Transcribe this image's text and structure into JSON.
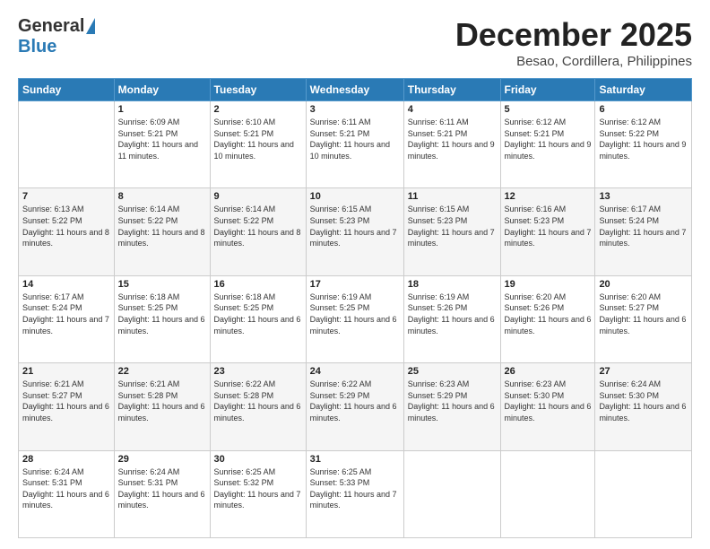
{
  "logo": {
    "general": "General",
    "blue": "Blue"
  },
  "title": {
    "month": "December 2025",
    "location": "Besao, Cordillera, Philippines"
  },
  "days_of_week": [
    "Sunday",
    "Monday",
    "Tuesday",
    "Wednesday",
    "Thursday",
    "Friday",
    "Saturday"
  ],
  "weeks": [
    [
      {
        "day": "",
        "info": ""
      },
      {
        "day": "1",
        "info": "Sunrise: 6:09 AM\nSunset: 5:21 PM\nDaylight: 11 hours and 11 minutes."
      },
      {
        "day": "2",
        "info": "Sunrise: 6:10 AM\nSunset: 5:21 PM\nDaylight: 11 hours and 10 minutes."
      },
      {
        "day": "3",
        "info": "Sunrise: 6:11 AM\nSunset: 5:21 PM\nDaylight: 11 hours and 10 minutes."
      },
      {
        "day": "4",
        "info": "Sunrise: 6:11 AM\nSunset: 5:21 PM\nDaylight: 11 hours and 9 minutes."
      },
      {
        "day": "5",
        "info": "Sunrise: 6:12 AM\nSunset: 5:21 PM\nDaylight: 11 hours and 9 minutes."
      },
      {
        "day": "6",
        "info": "Sunrise: 6:12 AM\nSunset: 5:22 PM\nDaylight: 11 hours and 9 minutes."
      }
    ],
    [
      {
        "day": "7",
        "info": "Sunrise: 6:13 AM\nSunset: 5:22 PM\nDaylight: 11 hours and 8 minutes."
      },
      {
        "day": "8",
        "info": "Sunrise: 6:14 AM\nSunset: 5:22 PM\nDaylight: 11 hours and 8 minutes."
      },
      {
        "day": "9",
        "info": "Sunrise: 6:14 AM\nSunset: 5:22 PM\nDaylight: 11 hours and 8 minutes."
      },
      {
        "day": "10",
        "info": "Sunrise: 6:15 AM\nSunset: 5:23 PM\nDaylight: 11 hours and 7 minutes."
      },
      {
        "day": "11",
        "info": "Sunrise: 6:15 AM\nSunset: 5:23 PM\nDaylight: 11 hours and 7 minutes."
      },
      {
        "day": "12",
        "info": "Sunrise: 6:16 AM\nSunset: 5:23 PM\nDaylight: 11 hours and 7 minutes."
      },
      {
        "day": "13",
        "info": "Sunrise: 6:17 AM\nSunset: 5:24 PM\nDaylight: 11 hours and 7 minutes."
      }
    ],
    [
      {
        "day": "14",
        "info": "Sunrise: 6:17 AM\nSunset: 5:24 PM\nDaylight: 11 hours and 7 minutes."
      },
      {
        "day": "15",
        "info": "Sunrise: 6:18 AM\nSunset: 5:25 PM\nDaylight: 11 hours and 6 minutes."
      },
      {
        "day": "16",
        "info": "Sunrise: 6:18 AM\nSunset: 5:25 PM\nDaylight: 11 hours and 6 minutes."
      },
      {
        "day": "17",
        "info": "Sunrise: 6:19 AM\nSunset: 5:25 PM\nDaylight: 11 hours and 6 minutes."
      },
      {
        "day": "18",
        "info": "Sunrise: 6:19 AM\nSunset: 5:26 PM\nDaylight: 11 hours and 6 minutes."
      },
      {
        "day": "19",
        "info": "Sunrise: 6:20 AM\nSunset: 5:26 PM\nDaylight: 11 hours and 6 minutes."
      },
      {
        "day": "20",
        "info": "Sunrise: 6:20 AM\nSunset: 5:27 PM\nDaylight: 11 hours and 6 minutes."
      }
    ],
    [
      {
        "day": "21",
        "info": "Sunrise: 6:21 AM\nSunset: 5:27 PM\nDaylight: 11 hours and 6 minutes."
      },
      {
        "day": "22",
        "info": "Sunrise: 6:21 AM\nSunset: 5:28 PM\nDaylight: 11 hours and 6 minutes."
      },
      {
        "day": "23",
        "info": "Sunrise: 6:22 AM\nSunset: 5:28 PM\nDaylight: 11 hours and 6 minutes."
      },
      {
        "day": "24",
        "info": "Sunrise: 6:22 AM\nSunset: 5:29 PM\nDaylight: 11 hours and 6 minutes."
      },
      {
        "day": "25",
        "info": "Sunrise: 6:23 AM\nSunset: 5:29 PM\nDaylight: 11 hours and 6 minutes."
      },
      {
        "day": "26",
        "info": "Sunrise: 6:23 AM\nSunset: 5:30 PM\nDaylight: 11 hours and 6 minutes."
      },
      {
        "day": "27",
        "info": "Sunrise: 6:24 AM\nSunset: 5:30 PM\nDaylight: 11 hours and 6 minutes."
      }
    ],
    [
      {
        "day": "28",
        "info": "Sunrise: 6:24 AM\nSunset: 5:31 PM\nDaylight: 11 hours and 6 minutes."
      },
      {
        "day": "29",
        "info": "Sunrise: 6:24 AM\nSunset: 5:31 PM\nDaylight: 11 hours and 6 minutes."
      },
      {
        "day": "30",
        "info": "Sunrise: 6:25 AM\nSunset: 5:32 PM\nDaylight: 11 hours and 7 minutes."
      },
      {
        "day": "31",
        "info": "Sunrise: 6:25 AM\nSunset: 5:33 PM\nDaylight: 11 hours and 7 minutes."
      },
      {
        "day": "",
        "info": ""
      },
      {
        "day": "",
        "info": ""
      },
      {
        "day": "",
        "info": ""
      }
    ]
  ]
}
